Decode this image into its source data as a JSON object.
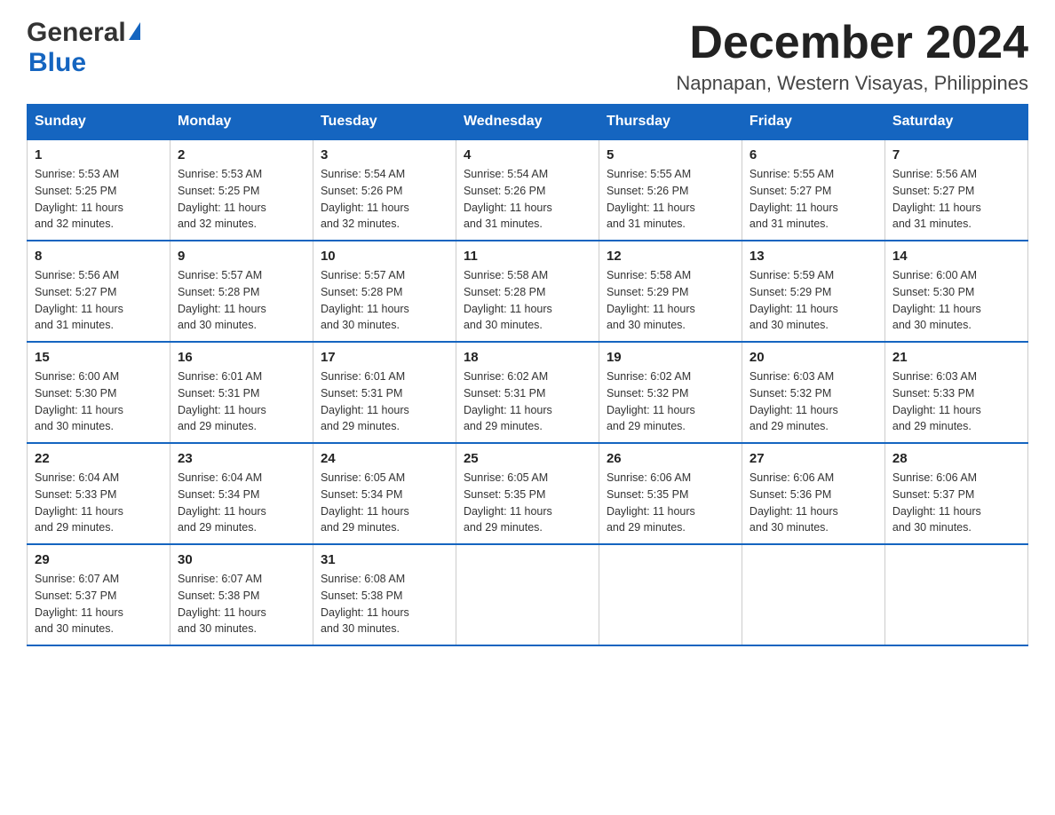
{
  "logo": {
    "general": "General",
    "blue": "Blue"
  },
  "header": {
    "month_year": "December 2024",
    "location": "Napnapan, Western Visayas, Philippines"
  },
  "weekdays": [
    "Sunday",
    "Monday",
    "Tuesday",
    "Wednesday",
    "Thursday",
    "Friday",
    "Saturday"
  ],
  "weeks": [
    [
      {
        "day": "1",
        "sunrise": "5:53 AM",
        "sunset": "5:25 PM",
        "daylight": "11 hours and 32 minutes."
      },
      {
        "day": "2",
        "sunrise": "5:53 AM",
        "sunset": "5:25 PM",
        "daylight": "11 hours and 32 minutes."
      },
      {
        "day": "3",
        "sunrise": "5:54 AM",
        "sunset": "5:26 PM",
        "daylight": "11 hours and 32 minutes."
      },
      {
        "day": "4",
        "sunrise": "5:54 AM",
        "sunset": "5:26 PM",
        "daylight": "11 hours and 31 minutes."
      },
      {
        "day": "5",
        "sunrise": "5:55 AM",
        "sunset": "5:26 PM",
        "daylight": "11 hours and 31 minutes."
      },
      {
        "day": "6",
        "sunrise": "5:55 AM",
        "sunset": "5:27 PM",
        "daylight": "11 hours and 31 minutes."
      },
      {
        "day": "7",
        "sunrise": "5:56 AM",
        "sunset": "5:27 PM",
        "daylight": "11 hours and 31 minutes."
      }
    ],
    [
      {
        "day": "8",
        "sunrise": "5:56 AM",
        "sunset": "5:27 PM",
        "daylight": "11 hours and 31 minutes."
      },
      {
        "day": "9",
        "sunrise": "5:57 AM",
        "sunset": "5:28 PM",
        "daylight": "11 hours and 30 minutes."
      },
      {
        "day": "10",
        "sunrise": "5:57 AM",
        "sunset": "5:28 PM",
        "daylight": "11 hours and 30 minutes."
      },
      {
        "day": "11",
        "sunrise": "5:58 AM",
        "sunset": "5:28 PM",
        "daylight": "11 hours and 30 minutes."
      },
      {
        "day": "12",
        "sunrise": "5:58 AM",
        "sunset": "5:29 PM",
        "daylight": "11 hours and 30 minutes."
      },
      {
        "day": "13",
        "sunrise": "5:59 AM",
        "sunset": "5:29 PM",
        "daylight": "11 hours and 30 minutes."
      },
      {
        "day": "14",
        "sunrise": "6:00 AM",
        "sunset": "5:30 PM",
        "daylight": "11 hours and 30 minutes."
      }
    ],
    [
      {
        "day": "15",
        "sunrise": "6:00 AM",
        "sunset": "5:30 PM",
        "daylight": "11 hours and 30 minutes."
      },
      {
        "day": "16",
        "sunrise": "6:01 AM",
        "sunset": "5:31 PM",
        "daylight": "11 hours and 29 minutes."
      },
      {
        "day": "17",
        "sunrise": "6:01 AM",
        "sunset": "5:31 PM",
        "daylight": "11 hours and 29 minutes."
      },
      {
        "day": "18",
        "sunrise": "6:02 AM",
        "sunset": "5:31 PM",
        "daylight": "11 hours and 29 minutes."
      },
      {
        "day": "19",
        "sunrise": "6:02 AM",
        "sunset": "5:32 PM",
        "daylight": "11 hours and 29 minutes."
      },
      {
        "day": "20",
        "sunrise": "6:03 AM",
        "sunset": "5:32 PM",
        "daylight": "11 hours and 29 minutes."
      },
      {
        "day": "21",
        "sunrise": "6:03 AM",
        "sunset": "5:33 PM",
        "daylight": "11 hours and 29 minutes."
      }
    ],
    [
      {
        "day": "22",
        "sunrise": "6:04 AM",
        "sunset": "5:33 PM",
        "daylight": "11 hours and 29 minutes."
      },
      {
        "day": "23",
        "sunrise": "6:04 AM",
        "sunset": "5:34 PM",
        "daylight": "11 hours and 29 minutes."
      },
      {
        "day": "24",
        "sunrise": "6:05 AM",
        "sunset": "5:34 PM",
        "daylight": "11 hours and 29 minutes."
      },
      {
        "day": "25",
        "sunrise": "6:05 AM",
        "sunset": "5:35 PM",
        "daylight": "11 hours and 29 minutes."
      },
      {
        "day": "26",
        "sunrise": "6:06 AM",
        "sunset": "5:35 PM",
        "daylight": "11 hours and 29 minutes."
      },
      {
        "day": "27",
        "sunrise": "6:06 AM",
        "sunset": "5:36 PM",
        "daylight": "11 hours and 30 minutes."
      },
      {
        "day": "28",
        "sunrise": "6:06 AM",
        "sunset": "5:37 PM",
        "daylight": "11 hours and 30 minutes."
      }
    ],
    [
      {
        "day": "29",
        "sunrise": "6:07 AM",
        "sunset": "5:37 PM",
        "daylight": "11 hours and 30 minutes."
      },
      {
        "day": "30",
        "sunrise": "6:07 AM",
        "sunset": "5:38 PM",
        "daylight": "11 hours and 30 minutes."
      },
      {
        "day": "31",
        "sunrise": "6:08 AM",
        "sunset": "5:38 PM",
        "daylight": "11 hours and 30 minutes."
      },
      null,
      null,
      null,
      null
    ]
  ],
  "labels": {
    "sunrise": "Sunrise:",
    "sunset": "Sunset:",
    "daylight": "Daylight:"
  }
}
